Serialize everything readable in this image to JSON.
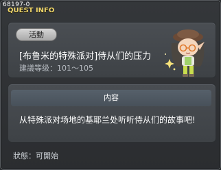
{
  "header": {
    "quest_id": "68197-0",
    "title": "QUEST INFO"
  },
  "quest": {
    "badge": "活動",
    "name": "[布鲁米的特殊派对]侍从们的压力",
    "level": "建議等级：101～105",
    "npc_icon": "npc-portrait"
  },
  "content": {
    "header": "内容",
    "description": "从特殊派对场地的基耶兰处听听侍从们的故事吧!"
  },
  "footer": {
    "status": "狀態：可開始"
  },
  "colors": {
    "title": "#f2d86a",
    "panel": "#3e4246"
  }
}
